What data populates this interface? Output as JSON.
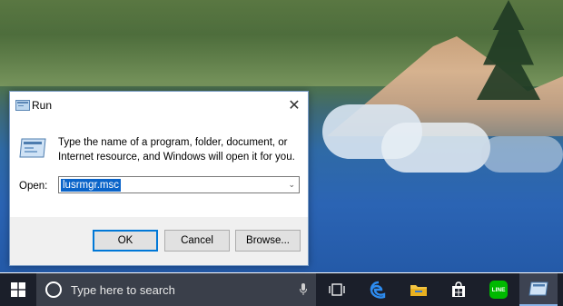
{
  "dialog": {
    "title": "Run",
    "description": "Type the name of a program, folder, document, or Internet resource, and Windows will open it for you.",
    "open_label": "Open:",
    "open_value": "lusrmgr.msc",
    "ok_label": "OK",
    "cancel_label": "Cancel",
    "browse_label": "Browse...",
    "close_glyph": "✕"
  },
  "taskbar": {
    "search_placeholder": "Type here to search",
    "icons": [
      "windows-start-icon",
      "cortana-icon",
      "microphone-icon",
      "task-view-icon",
      "edge-icon",
      "file-explorer-icon",
      "store-icon",
      "line-icon",
      "run-icon"
    ],
    "line_badge_text": "LINE"
  },
  "colors": {
    "taskbar_bg": "#1b1f2a",
    "search_bg": "#3a3f4a",
    "accent": "#0078d7",
    "selection": "#0a64c9",
    "line_green": "#00b900"
  }
}
